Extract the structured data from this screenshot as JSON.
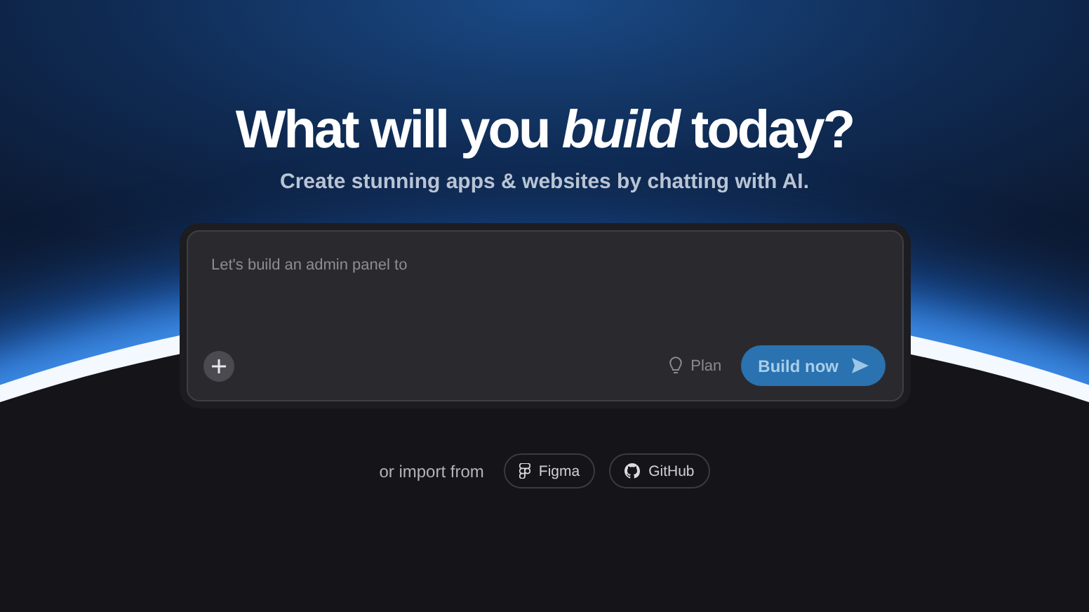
{
  "hero": {
    "title": "What will you *build* today?",
    "subtitle": "Create stunning apps & websites by chatting with AI."
  },
  "prompt": {
    "placeholder": "Let's build an admin panel to",
    "plan_label": "Plan",
    "build_label": "Build now"
  },
  "import": {
    "label": "or import from",
    "sources": [
      {
        "kind": "figma",
        "label": "Figma"
      },
      {
        "kind": "github",
        "label": "GitHub"
      }
    ]
  }
}
